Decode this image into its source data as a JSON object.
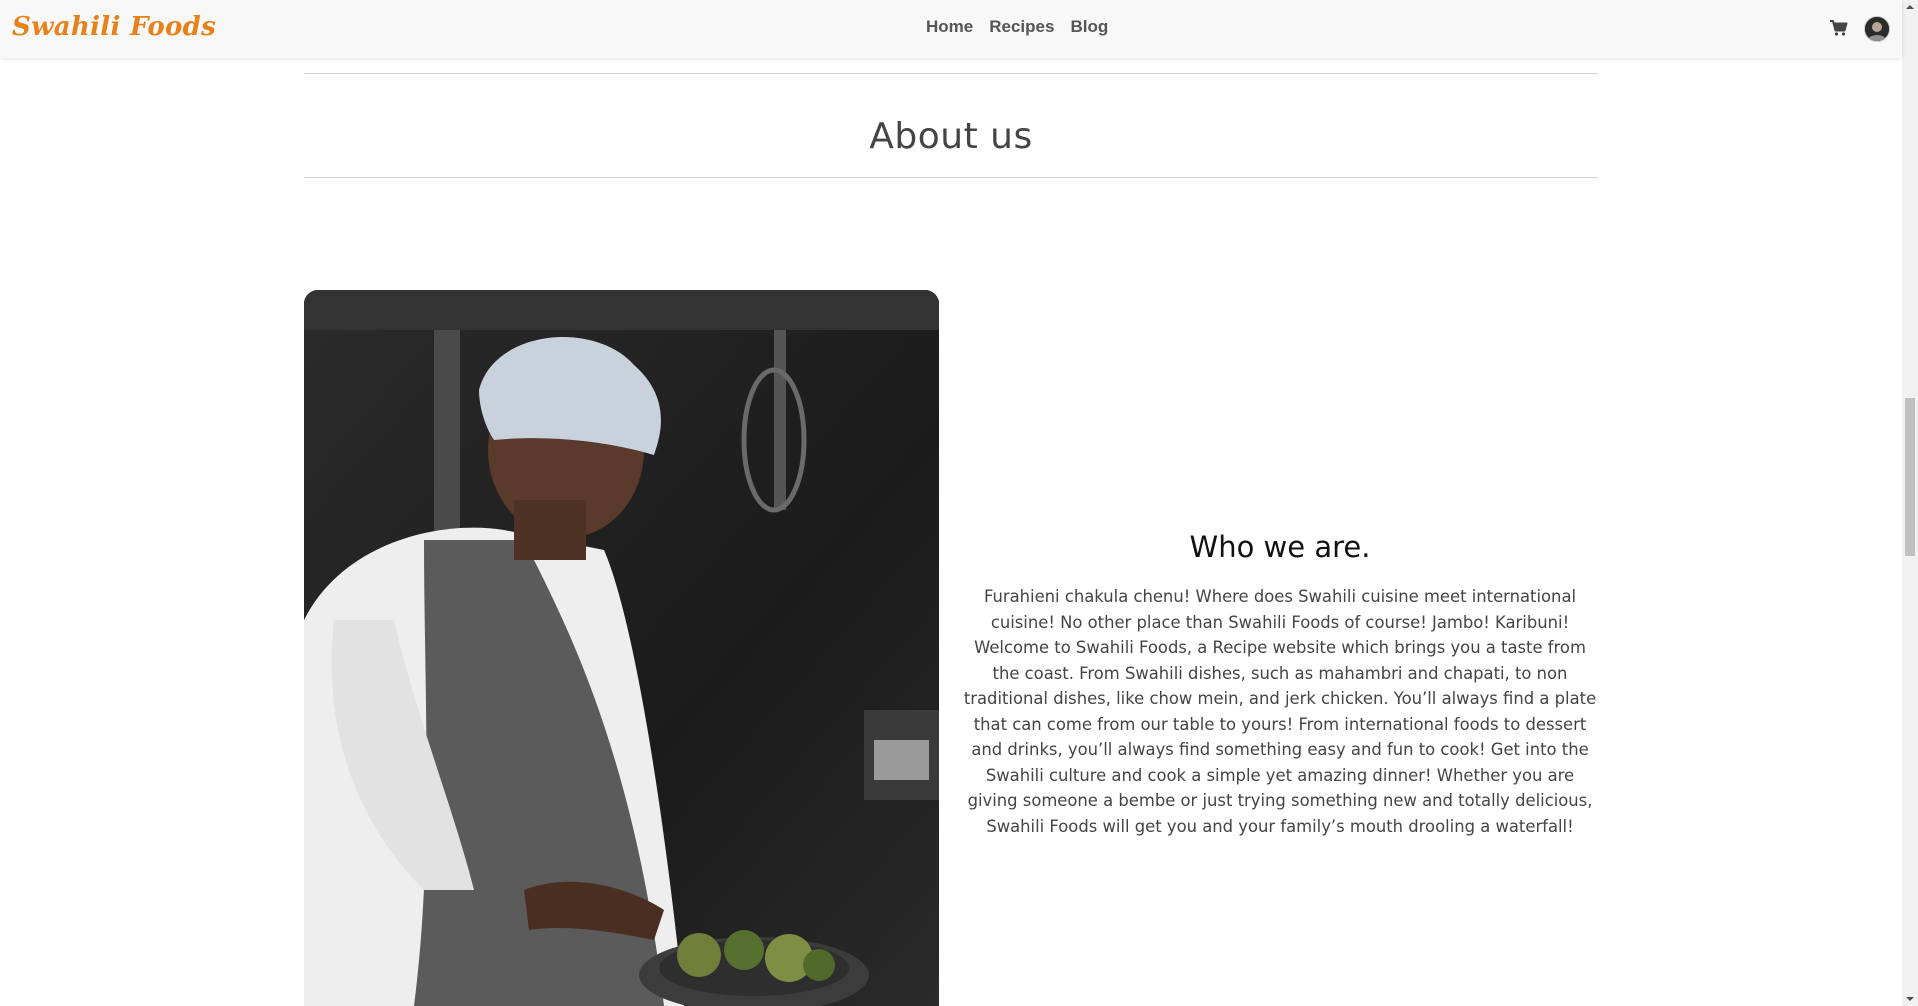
{
  "navbar": {
    "brand": "Swahili Foods",
    "links": [
      "Home",
      "Recipes",
      "Blog"
    ],
    "cart_icon": "cart-icon",
    "avatar_icon": "user-avatar"
  },
  "about": {
    "title": "About us",
    "heading": "Who we are.",
    "body": "Furahieni chakula chenu! Where does Swahili cuisine meet international cuisine! No other place than Swahili Foods of course! Jambo! Karibuni! Welcome to Swahili Foods, a Recipe website which brings you a taste from the coast. From Swahili dishes, such as mahambri and chapati, to non traditional dishes, like chow mein, and jerk chicken. You’ll always find a plate that can come from our table to yours! From international foods to dessert and drinks, you’ll always find something easy and fun to cook! Get into the Swahili culture and cook a simple yet amazing dinner! Whether you are giving someone a bembe or just trying something new and totally delicious, Swahili Foods will get you and your family’s mouth drooling a waterfall!",
    "image_subject": "chef-photo"
  },
  "colors": {
    "brand": "#e8811a",
    "nav_text": "#555555",
    "navbar_bg": "#f8f8f8",
    "rule": "#d4d4d4"
  }
}
